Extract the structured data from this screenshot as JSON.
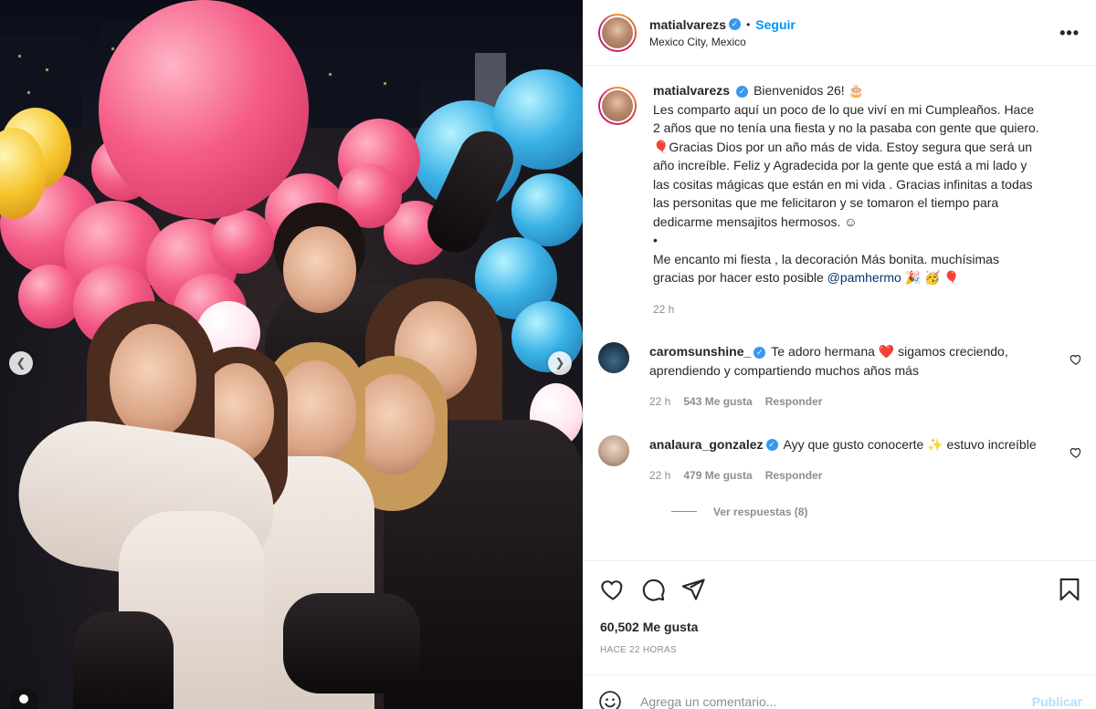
{
  "post": {
    "author": {
      "username": "matialvarezs",
      "verified": true,
      "follow_label": "Seguir",
      "location": "Mexico City, Mexico"
    },
    "more_icon": "more-options-icon",
    "caption": {
      "lines": [
        "Bienvenidos 26! 🎂",
        "Les comparto aquí un poco de lo que viví en mi Cumpleaños. Hace",
        "2 años que no tenía una fiesta y no la pasaba con gente que quiero.",
        "🎈Gracias Dios por un año más de vida. Estoy segura que será un",
        "año increíble. Feliz y Agradecida por la gente que está a mi lado y",
        "las cositas mágicas que están en mi vida . Gracias infinitas a todas",
        "las personitas que me felicitaron y se tomaron el tiempo para",
        "dedicarme mensajitos hermosos. ☺",
        "•",
        "Me encanto mi fiesta , la decoración Más bonita. muchísimas",
        "gracias por hacer esto posible"
      ],
      "mention": "@pamhermo",
      "trailing_emoji": " 🎉 🥳 🎈",
      "time": "22 h"
    },
    "comments": [
      {
        "username": "caromsunshine_",
        "verified": true,
        "text": "Te adoro hermana ❤️ sigamos creciendo, aprendiendo y compartiendo muchos años más",
        "time": "22 h",
        "likes": "543 Me gusta",
        "reply_label": "Responder"
      },
      {
        "username": "analaura_gonzalez",
        "verified": true,
        "text": "Ayy que gusto conocerte ✨ estuvo increíble",
        "time": "22 h",
        "likes": "479 Me gusta",
        "reply_label": "Responder"
      }
    ],
    "view_replies": "Ver respuestas (8)",
    "likes_count": "60,502 Me gusta",
    "time_ago": "HACE 22 HORAS",
    "comment_input": {
      "placeholder": "Agrega un comentario...",
      "publish_label": "Publicar"
    },
    "icons": [
      "heart-icon",
      "comment-icon",
      "share-icon",
      "bookmark-icon",
      "emoji-icon",
      "chevron-left-icon",
      "chevron-right-icon",
      "user-tag-icon"
    ],
    "colors": {
      "link_blue": "#0095f6",
      "verified_blue": "#3897f0",
      "mention": "#00376b",
      "muted": "#8e8e8e",
      "publish_disabled": "#b2dffc"
    }
  }
}
